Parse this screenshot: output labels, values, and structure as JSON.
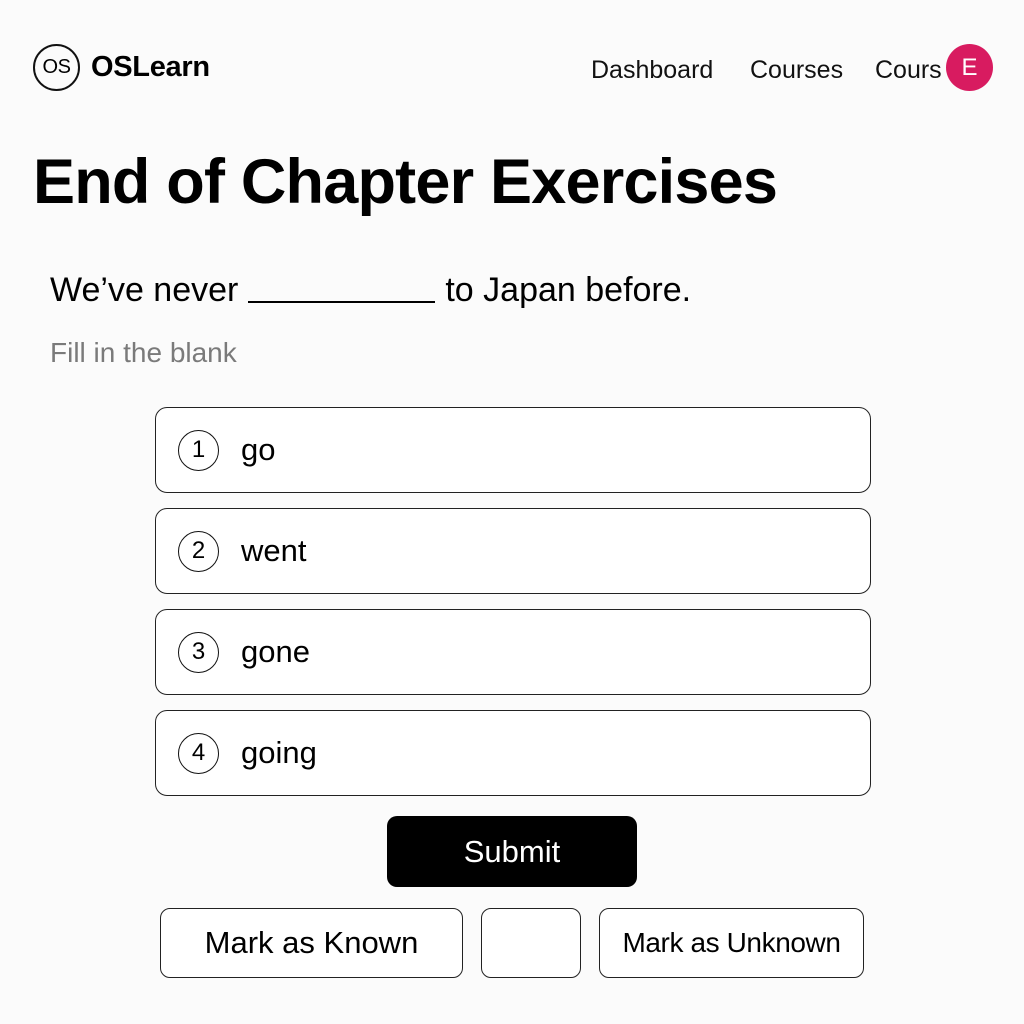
{
  "brand": {
    "logo_text": "OS",
    "name": "OSLearn"
  },
  "nav": {
    "links": [
      "Dashboard",
      "Courses",
      "Cours"
    ],
    "avatar_initial": "E",
    "avatar_color": "#d81b60"
  },
  "page": {
    "title": "End of Chapter Exercises",
    "question_before": "We’ve never",
    "question_after": "to Japan before.",
    "instruction": "Fill in the blank"
  },
  "options": [
    {
      "number": "1",
      "label": "go"
    },
    {
      "number": "2",
      "label": "went"
    },
    {
      "number": "3",
      "label": "gone"
    },
    {
      "number": "4",
      "label": "going"
    }
  ],
  "actions": {
    "submit": "Submit",
    "mark_known": "Mark as Known",
    "middle": "",
    "mark_unknown": "Mark as Unknown"
  },
  "colors": {
    "primary_button": "#000000",
    "avatar": "#d81b60"
  }
}
